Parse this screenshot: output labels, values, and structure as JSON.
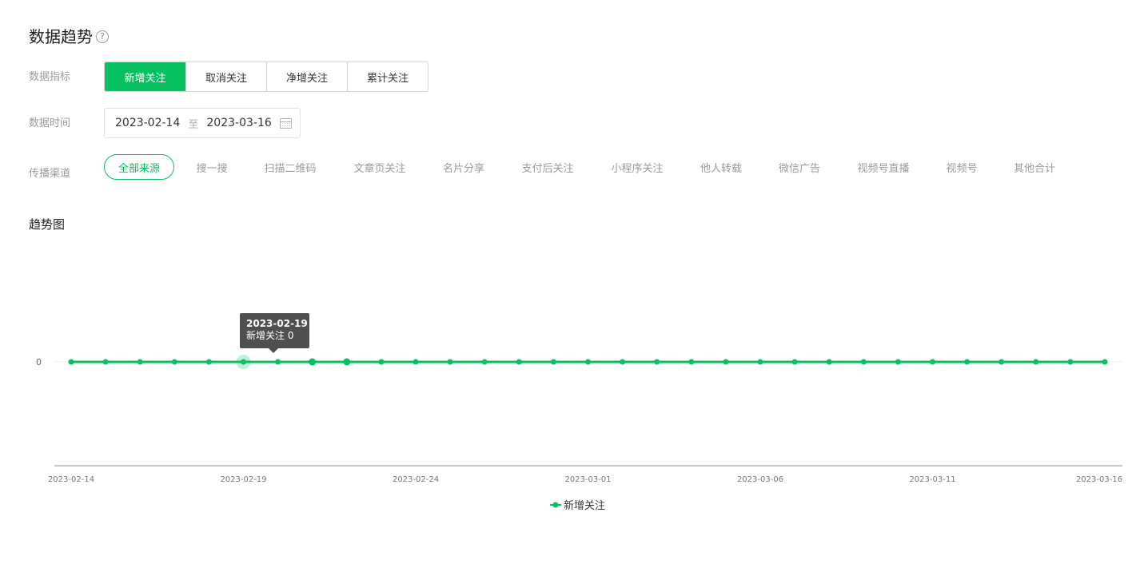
{
  "header": {
    "title": "数据趋势",
    "help_icon": "question-circle-icon",
    "help_glyph": "?"
  },
  "metric": {
    "label": "数据指标",
    "options": [
      "新增关注",
      "取消关注",
      "净增关注",
      "累计关注"
    ],
    "selected": "新增关注"
  },
  "date_range": {
    "label": "数据时间",
    "start": "2023-02-14",
    "separator": "至",
    "end": "2023-03-16",
    "icon": "calendar-icon"
  },
  "channel": {
    "label": "传播渠道",
    "options": [
      "全部来源",
      "搜一搜",
      "扫描二维码",
      "文章页关注",
      "名片分享",
      "支付后关注",
      "小程序关注",
      "他人转载",
      "微信广告",
      "视频号直播",
      "视频号",
      "其他合计"
    ],
    "selected": "全部来源"
  },
  "trend": {
    "title": "趋势图"
  },
  "colors": {
    "accent": "#07c160",
    "tooltip_bg": "#4f4f4f",
    "axis": "#c8c8c8"
  },
  "tooltip": {
    "date": "2023-02-19",
    "text": "新增关注 0"
  },
  "chart_data": {
    "type": "line",
    "series": [
      {
        "name": "新增关注",
        "x": [
          "2023-02-14",
          "2023-02-15",
          "2023-02-16",
          "2023-02-17",
          "2023-02-18",
          "2023-02-19",
          "2023-02-20",
          "2023-02-21",
          "2023-02-22",
          "2023-02-23",
          "2023-02-24",
          "2023-02-25",
          "2023-02-26",
          "2023-02-27",
          "2023-02-28",
          "2023-03-01",
          "2023-03-02",
          "2023-03-03",
          "2023-03-04",
          "2023-03-05",
          "2023-03-06",
          "2023-03-07",
          "2023-03-08",
          "2023-03-09",
          "2023-03-10",
          "2023-03-11",
          "2023-03-12",
          "2023-03-13",
          "2023-03-14",
          "2023-03-15",
          "2023-03-16"
        ],
        "values": [
          0,
          0,
          0,
          0,
          0,
          0,
          0,
          0,
          0,
          0,
          0,
          0,
          0,
          0,
          0,
          0,
          0,
          0,
          0,
          0,
          0,
          0,
          0,
          0,
          0,
          0,
          0,
          0,
          0,
          0,
          0
        ]
      }
    ],
    "x_ticks": [
      "2023-02-14",
      "2023-02-19",
      "2023-02-24",
      "2023-03-01",
      "2023-03-06",
      "2023-03-11",
      "2023-03-16"
    ],
    "y_ticks": [
      "0"
    ],
    "highlighted": "2023-02-19",
    "legend": "bottom-center"
  }
}
